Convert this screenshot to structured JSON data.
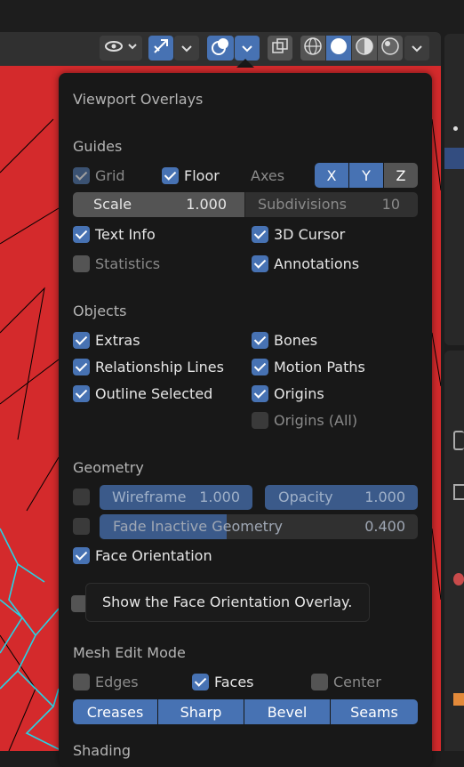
{
  "popup": {
    "title": "Viewport Overlays",
    "guides": {
      "heading": "Guides",
      "grid": {
        "label": "Grid",
        "checked": true,
        "enabled": false
      },
      "floor": {
        "label": "Floor",
        "checked": true
      },
      "axes": {
        "label": "Axes",
        "x": "X",
        "y": "Y",
        "z": "Z"
      },
      "scale": {
        "label": "Scale",
        "value": "1.000"
      },
      "subdivisions": {
        "label": "Subdivisions",
        "value": "10"
      },
      "text_info": {
        "label": "Text Info",
        "checked": true
      },
      "cursor_3d": {
        "label": "3D Cursor",
        "checked": true
      },
      "statistics": {
        "label": "Statistics",
        "checked": false
      },
      "annotations": {
        "label": "Annotations",
        "checked": true
      }
    },
    "objects": {
      "heading": "Objects",
      "extras": {
        "label": "Extras",
        "checked": true
      },
      "bones": {
        "label": "Bones",
        "checked": true
      },
      "relationship_lines": {
        "label": "Relationship Lines",
        "checked": true
      },
      "motion_paths": {
        "label": "Motion Paths",
        "checked": true
      },
      "outline_selected": {
        "label": "Outline Selected",
        "checked": true
      },
      "origins": {
        "label": "Origins",
        "checked": true
      },
      "origins_all": {
        "label": "Origins (All)",
        "checked": false
      }
    },
    "geometry": {
      "heading": "Geometry",
      "wireframe": {
        "label": "Wireframe",
        "value": "1.000",
        "checked": false
      },
      "opacity": {
        "label": "Opacity",
        "value": "1.000"
      },
      "fade_inactive": {
        "label": "Fade Inactive Geometry",
        "value": "0.400",
        "checked": false,
        "fraction": 0.4
      },
      "face_orientation": {
        "label": "Face Orientation",
        "checked": true
      }
    },
    "tooltip": "Show the Face Orientation Overlay.",
    "mesh_edit": {
      "heading": "Mesh Edit Mode",
      "edges": {
        "label": "Edges",
        "checked": false
      },
      "faces": {
        "label": "Faces",
        "checked": true
      },
      "center": {
        "label": "Center",
        "checked": false
      },
      "buttons": [
        "Creases",
        "Sharp",
        "Bevel",
        "Seams"
      ]
    },
    "shading_heading": "Shading"
  },
  "colors": {
    "accent": "#4772b3",
    "popup_bg": "#181818",
    "viewport": "#d42a2c"
  },
  "header_icons": [
    "visibility-eye-icon",
    "gizmo-icon",
    "overlays-icon",
    "xray-icon",
    "wireframe-shading-icon",
    "solid-shading-icon",
    "material-preview-icon",
    "rendered-shading-icon"
  ]
}
